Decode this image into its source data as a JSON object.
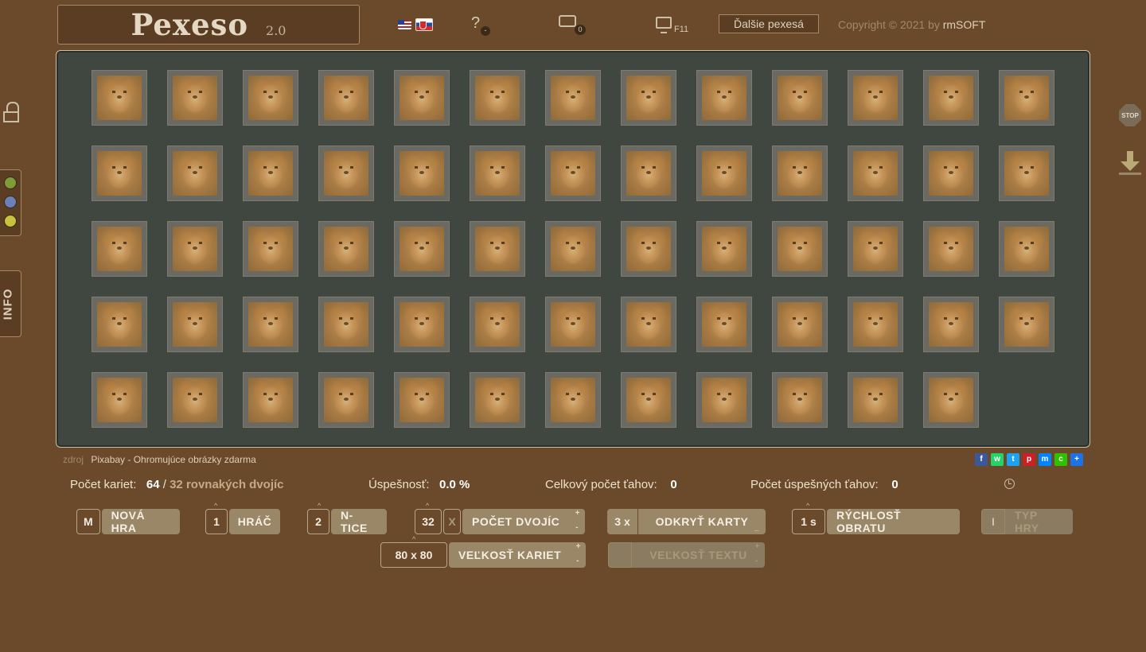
{
  "header": {
    "title": "Pexeso",
    "version": "2.0",
    "help_symbol": "?",
    "help_badge": "-",
    "keyboard_badge": "0",
    "fullscreen_key": "F11",
    "more_button": "Ďalšie pexesá",
    "copyright_prefix": "Copyright © 2021 by",
    "copyright_brand": "rmSOFT"
  },
  "board": {
    "columns": 13,
    "card_count": 64,
    "card_image": "lion-face"
  },
  "source": {
    "label": "zdroj",
    "text": "Pixabay - Ohromujúce obrázky zdarma"
  },
  "share": [
    {
      "icon": "facebook-icon",
      "glyph": "f",
      "color": "#3b5998"
    },
    {
      "icon": "whatsapp-icon",
      "glyph": "w",
      "color": "#25d366"
    },
    {
      "icon": "twitter-icon",
      "glyph": "t",
      "color": "#1da1f2"
    },
    {
      "icon": "pinterest-icon",
      "glyph": "p",
      "color": "#cb2027"
    },
    {
      "icon": "messenger-icon",
      "glyph": "m",
      "color": "#0084ff"
    },
    {
      "icon": "wechat-icon",
      "glyph": "c",
      "color": "#2dc100"
    },
    {
      "icon": "more-share-icon",
      "glyph": "+",
      "color": "#1d72e8"
    }
  ],
  "stats": {
    "cards_label": "Počet kariet:",
    "cards_value": "64",
    "pairs_sep": "/",
    "pairs_value": "32",
    "pairs_label": "rovnakých dvojíc",
    "success_label": "Úspešnosť:",
    "success_value": "0.0 %",
    "moves_label": "Celkový počet ťahov:",
    "moves_value": "0",
    "good_moves_label": "Počet úspešných ťahov:",
    "good_moves_value": "0"
  },
  "controls": {
    "new_game": {
      "key": "M",
      "label": "NOVÁ HRA"
    },
    "players": {
      "value": "1",
      "label": "HRÁČ",
      "caret": "^"
    },
    "ntice": {
      "value": "2",
      "label": "N-TICE",
      "caret": "^"
    },
    "pairs": {
      "value": "32",
      "x": "X",
      "label": "POČET DVOJÍC",
      "caret": "^",
      "inc": "+",
      "dec": "-"
    },
    "reveal": {
      "value": "3 x",
      "label": "ODKRYŤ KARTY",
      "dec": "_"
    },
    "speed": {
      "value": "1 s",
      "label": "RÝCHLOSŤ OBRATU",
      "caret": "^"
    },
    "game_type": {
      "value": "I",
      "label": "TYP HRY"
    },
    "card_size": {
      "value": "80 x 80",
      "label": "VEĽKOSŤ KARIET",
      "caret": "^",
      "inc": "+",
      "dec": "-"
    },
    "text_size": {
      "value": "",
      "label": "VEĽKOSŤ TEXTU",
      "inc": "+",
      "dec": "-"
    }
  },
  "colors": {
    "background": "#6b4a2b",
    "board": "#404741",
    "button": "#9a8768",
    "dot_green": "#7e9d3a",
    "dot_blue": "#6b7fb8",
    "dot_yellow": "#c9c23c"
  },
  "side": {
    "info_label": "INFO",
    "stop_label": "STOP"
  }
}
